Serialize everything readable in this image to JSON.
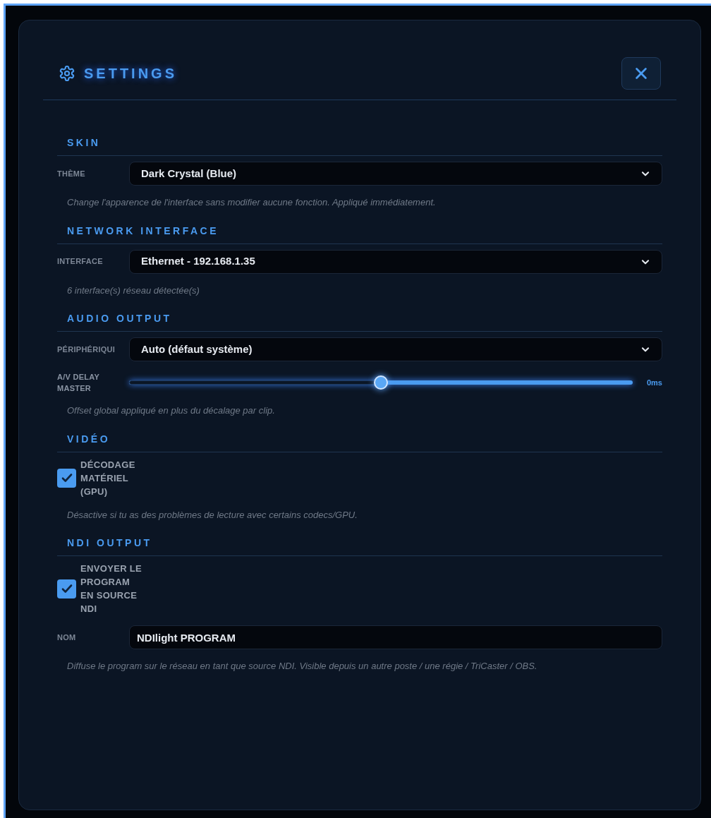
{
  "dialog": {
    "title": "SETTINGS"
  },
  "sections": [
    {
      "heading": "SKIN",
      "rows": [
        {
          "kind": "select",
          "label": "THÈME",
          "value": "Dark Crystal (Blue)"
        }
      ],
      "hint": "Change l'apparence de l'interface sans modifier aucune fonction. Appliqué immédiatement."
    },
    {
      "heading": "NETWORK INTERFACE",
      "rows": [
        {
          "kind": "select",
          "label": "INTERFACE",
          "value": "Ethernet - 192.168.1.35"
        }
      ],
      "hint": "6 interface(s) réseau détectée(s)"
    },
    {
      "heading": "AUDIO OUTPUT",
      "rows": [
        {
          "kind": "select",
          "label": "PÉRIPHÉRIQUI",
          "value": "Auto (défaut système)"
        },
        {
          "kind": "slider",
          "label": "A/V DELAY MASTER",
          "level": 0.5,
          "reading": "0ms"
        }
      ],
      "hint": "Offset global appliqué en plus du décalage par clip."
    },
    {
      "heading": "VIDÉO",
      "rows": [
        {
          "kind": "checkbox",
          "label": "DÉCODAGE MATÉRIEL (GPU)",
          "checked": true
        }
      ],
      "hint": "Désactive si tu as des problèmes de lecture avec certains codecs/GPU."
    },
    {
      "heading": "NDI OUTPUT",
      "rows": [
        {
          "kind": "checkbox",
          "label": "ENVOYER LE PROGRAM EN SOURCE NDI",
          "checked": true
        },
        {
          "kind": "text",
          "label": "NOM",
          "value": "NDIlight PROGRAM"
        }
      ],
      "hint": "Diffuse le program sur le réseau en tant que source NDI. Visible depuis un autre poste / une régie / TriCaster / OBS."
    }
  ]
}
